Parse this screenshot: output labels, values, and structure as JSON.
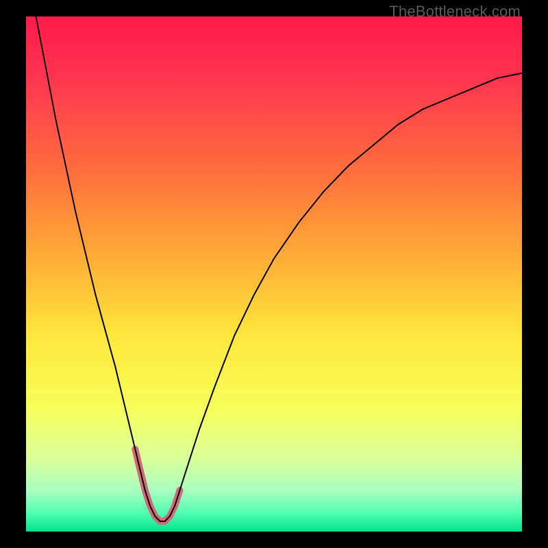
{
  "watermark": "TheBottleneck.com",
  "chart_data": {
    "type": "line",
    "title": "",
    "xlabel": "",
    "ylabel": "",
    "xlim": [
      0,
      100
    ],
    "ylim": [
      0,
      100
    ],
    "grid": false,
    "background_gradient": {
      "stops": [
        {
          "pos": 0.0,
          "color": "#ff1a4a"
        },
        {
          "pos": 0.12,
          "color": "#ff3550"
        },
        {
          "pos": 0.3,
          "color": "#ff6e3c"
        },
        {
          "pos": 0.48,
          "color": "#ffb136"
        },
        {
          "pos": 0.62,
          "color": "#ffe73c"
        },
        {
          "pos": 0.76,
          "color": "#f7ff59"
        },
        {
          "pos": 0.86,
          "color": "#d9ff9a"
        },
        {
          "pos": 0.92,
          "color": "#a8ffc0"
        },
        {
          "pos": 0.965,
          "color": "#4dffb0"
        },
        {
          "pos": 1.0,
          "color": "#00e28a"
        }
      ]
    },
    "series": [
      {
        "name": "bottleneck-curve",
        "color": "#000000",
        "width": 2,
        "x": [
          0,
          2,
          4,
          6,
          8,
          10,
          12,
          14,
          16,
          18,
          20,
          22,
          23,
          24,
          25,
          26,
          27,
          28,
          29,
          30,
          31,
          33,
          35,
          38,
          42,
          46,
          50,
          55,
          60,
          65,
          70,
          75,
          80,
          85,
          90,
          95,
          100
        ],
        "y": [
          110,
          100,
          90,
          80,
          71,
          62,
          54,
          46,
          39,
          32,
          24,
          16,
          12,
          8,
          5,
          3,
          2,
          2,
          3,
          5,
          8,
          14,
          20,
          28,
          38,
          46,
          53,
          60,
          66,
          71,
          75,
          79,
          82,
          84,
          86,
          88,
          89
        ]
      },
      {
        "name": "trough-highlight",
        "color": "#d16a7a",
        "width": 10,
        "cap": "round",
        "x": [
          22,
          23,
          24,
          25,
          26,
          27,
          28,
          29,
          30,
          31
        ],
        "y": [
          16,
          12,
          8,
          5,
          3,
          2,
          2,
          3,
          5,
          8
        ]
      }
    ]
  }
}
